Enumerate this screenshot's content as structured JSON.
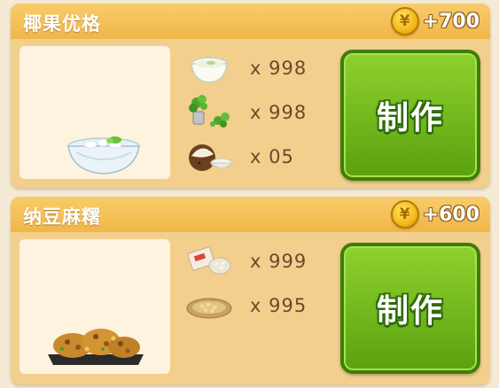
{
  "recipes": [
    {
      "name": "椰果优格",
      "reward": "+700",
      "coin_symbol": "¥",
      "dish_icon": "coconut-yogurt-bowl",
      "ingredients": [
        {
          "icon": "yogurt-bowl-icon",
          "qty": "x 998"
        },
        {
          "icon": "herb-pot-icon",
          "qty": "x 998"
        },
        {
          "icon": "coconut-icon",
          "qty": "x 05"
        }
      ],
      "button_label": "制作"
    },
    {
      "name": "纳豆麻糬",
      "reward": "+600",
      "coin_symbol": "¥",
      "dish_icon": "natto-mochi-plate",
      "ingredients": [
        {
          "icon": "rice-packet-icon",
          "qty": "x 999"
        },
        {
          "icon": "soybean-plate-icon",
          "qty": "x 995"
        }
      ],
      "button_label": "制作"
    }
  ],
  "colors": {
    "card": "#f3cf8e",
    "header": "#f0b648",
    "button": "#6ab81a",
    "qty_text": "#6a4a2a"
  }
}
